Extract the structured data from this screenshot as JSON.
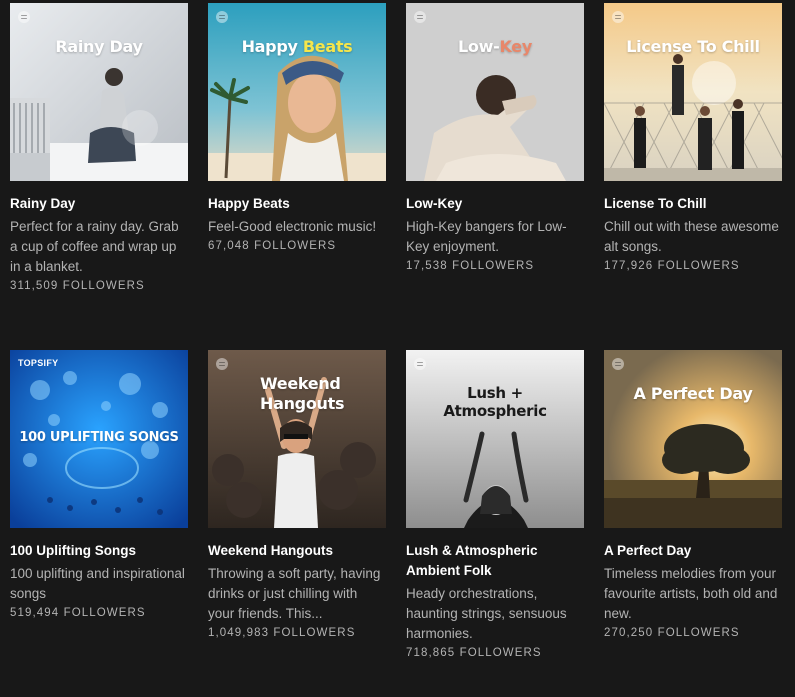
{
  "playlists": [
    {
      "name": "Rainy Day",
      "cover_text": "Rainy Day",
      "description": "Perfect for a rainy day. Grab a cup of coffee and wrap up in a blanket.",
      "followers": "311,509 FOLLOWERS"
    },
    {
      "name": "Happy Beats",
      "cover_text": "Happy",
      "cover_text_accent": "Beats",
      "description": "Feel-Good electronic music!",
      "followers": "67,048 FOLLOWERS"
    },
    {
      "name": "Low-Key",
      "cover_text": "Low-",
      "cover_text_accent": "Key",
      "description": "High-Key bangers for Low-Key enjoyment.",
      "followers": "17,538 FOLLOWERS"
    },
    {
      "name": "License To Chill",
      "cover_text": "License To Chill",
      "description": "Chill out with these awesome alt songs.",
      "followers": "177,926 FOLLOWERS"
    },
    {
      "name": "100 Uplifting Songs",
      "cover_text": "100 UPLIFTING SONGS",
      "cover_brand": "TOPSIFY",
      "description": "100 uplifting and inspirational songs",
      "followers": "519,494 FOLLOWERS"
    },
    {
      "name": "Weekend Hangouts",
      "cover_text": "Weekend Hangouts",
      "description": "Throwing a soft party, having drinks or just chilling with your friends. This...",
      "followers": "1,049,983 FOLLOWERS"
    },
    {
      "name": "Lush & Atmospheric Ambient Folk",
      "cover_text": "Lush + Atmospheric",
      "description": "Heady orchestrations, haunting strings, sensuous harmonies.",
      "followers": "718,865 FOLLOWERS"
    },
    {
      "name": "A Perfect Day",
      "cover_text": "A Perfect Day",
      "description": "Timeless melodies from your favourite artists, both old and new.",
      "followers": "270,250 FOLLOWERS"
    }
  ],
  "colors": {
    "background": "#181818",
    "title": "#ffffff",
    "subtext": "#b3b3b3",
    "happy_accent": "#f5e64b",
    "lowkey_accent": "#e8876a"
  }
}
